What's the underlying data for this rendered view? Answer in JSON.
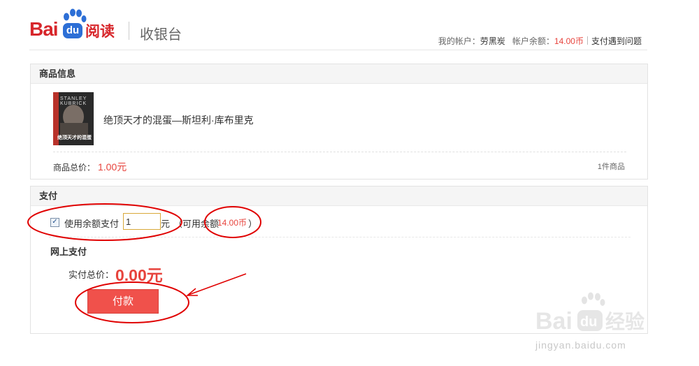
{
  "header": {
    "logo_text_bai": "Bai",
    "logo_text_du": "du",
    "logo_text_read": "阅读",
    "logo_subtitle": "收银台",
    "account_label": "我的帐户：",
    "account_name": "劳黑炭",
    "balance_label": "帐户余额：",
    "balance_value": "14.00币",
    "help_link": "支付遇到问题"
  },
  "product_panel": {
    "title": "商品信息",
    "book_title": "绝顶天才的混蛋—斯坦利·库布里克",
    "cover_text_top": "STANLEY KUBRICK",
    "cover_text": "绝顶天才的混蛋",
    "total_label": "商品总价：",
    "total_value": "1.00元",
    "item_count": "1件商品"
  },
  "pay_panel": {
    "title": "支付",
    "use_balance_label": "使用余额支付",
    "use_balance_checked": true,
    "balance_input_value": "1",
    "unit": "元",
    "available_prefix": "（可用余额",
    "available_amount": "14.00币",
    "available_suffix": "）",
    "online_title": "网上支付",
    "actual_total_label": "实付总价：",
    "actual_total_value": "0.00元",
    "pay_button": "付款"
  },
  "watermark": {
    "text": "jingyan.baidu.com",
    "brand_text": "经验"
  },
  "colors": {
    "brand_red": "#d7262b",
    "price_red": "#e7433c",
    "pay_button": "#f0514b",
    "annotation_red": "#e00000",
    "baidu_blue": "#2d6fd6"
  },
  "icons": [
    "baidu-paw-icon",
    "checkbox-checked-icon"
  ]
}
